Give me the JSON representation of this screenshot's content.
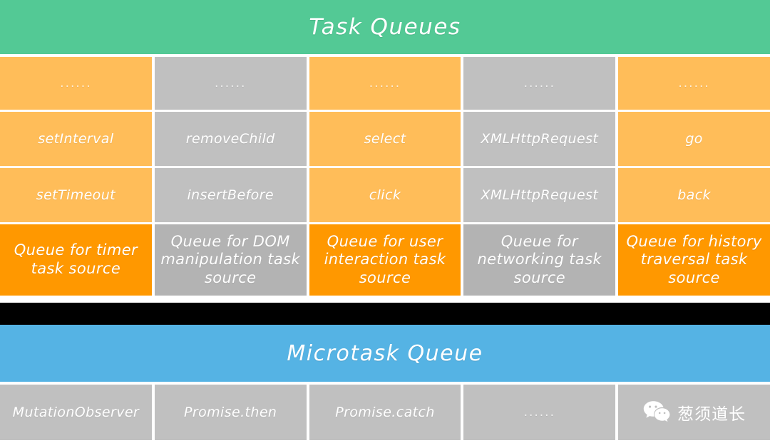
{
  "task_queues": {
    "title": "Task Queues",
    "banner_color": "#53c995",
    "ellipsis": "......",
    "columns": [
      {
        "id": "timer",
        "color": "#ffbd59",
        "footer_color": "#ff9800",
        "dots": "......",
        "items": [
          "setInterval",
          "setTimeout"
        ],
        "footer": "Queue for timer task source"
      },
      {
        "id": "dom",
        "color": "#c0c0c0",
        "footer_color": "#b3b3b3",
        "dots": "......",
        "items": [
          "removeChild",
          "insertBefore"
        ],
        "footer": "Queue for DOM manipulation task source"
      },
      {
        "id": "user-interaction",
        "color": "#ffbd59",
        "footer_color": "#ff9800",
        "dots": "......",
        "items": [
          "select",
          "click"
        ],
        "footer": "Queue for user interaction task source"
      },
      {
        "id": "networking",
        "color": "#c0c0c0",
        "footer_color": "#b3b3b3",
        "dots": "......",
        "items": [
          "XMLHttpRequest",
          "XMLHttpRequest"
        ],
        "footer": "Queue for networking task source"
      },
      {
        "id": "history-traversal",
        "color": "#ffbd59",
        "footer_color": "#ff9800",
        "dots": "......",
        "items": [
          "go",
          "back"
        ],
        "footer": "Queue for history traversal task source"
      }
    ]
  },
  "microtask_queue": {
    "title": "Microtask Queue",
    "banner_color": "#55b3e4",
    "cell_color": "#c0c0c0",
    "cells": [
      "MutationObserver",
      "Promise.then",
      "Promise.catch",
      "......"
    ],
    "watermark": {
      "icon": "wechat-icon",
      "text": "葱须道长"
    }
  },
  "separator": {
    "color": "#000000"
  }
}
